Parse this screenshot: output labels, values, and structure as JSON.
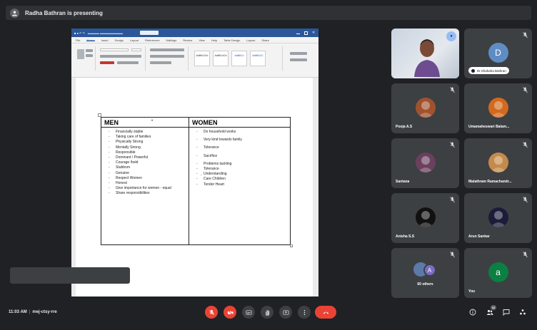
{
  "presenter_banner": {
    "text": "Radha Bathran is presenting"
  },
  "word": {
    "menu_tabs": [
      "File",
      "Home",
      "Insert",
      "Design",
      "Layout",
      "References",
      "Mailings",
      "Review",
      "View",
      "Help",
      "Table Design",
      "Layout",
      "Share"
    ],
    "active_tab": "Home"
  },
  "document": {
    "table": {
      "headers": [
        "MEN",
        "WOMEN"
      ],
      "men_items": [
        "Financially stable",
        "Taking care of families",
        "Physically Strong",
        "Mentally Strong",
        "Responsible",
        "Dominant / Powerful",
        "Courage /bold",
        "Stubborn",
        "Genuine",
        "Respect Women",
        "Honest",
        "Give importance for women - equal",
        "Share responsibilities"
      ],
      "women_items_spaced": [
        "Do household works",
        "Very kind towards family",
        "Tolerance",
        "Sacrifice"
      ],
      "women_items_tight": [
        "Problems tackling",
        "Tolerance",
        "Understanding",
        "Care Children",
        "Tender Heart"
      ]
    }
  },
  "participants": [
    {
      "name": "",
      "type": "video",
      "chip": ""
    },
    {
      "name": "Dr.Shahaha Bathran",
      "type": "letter",
      "letter": "D",
      "color": "#5f8dc3"
    },
    {
      "name": "Pooja A.S",
      "type": "photo",
      "color": "#a0522d"
    },
    {
      "name": "Umamaheswari Balam...",
      "type": "photo",
      "color": "#d2691e"
    },
    {
      "name": "Santana",
      "type": "photo",
      "color": "#6b3f5e"
    },
    {
      "name": "Malathram Ramachandr...",
      "type": "photo",
      "color": "#c58a4a"
    },
    {
      "name": "Anisha S.S",
      "type": "photo",
      "color": "#111111"
    },
    {
      "name": "Arun Sankar",
      "type": "photo",
      "color": "#1c1c3a"
    },
    {
      "name": "60 others",
      "type": "group"
    },
    {
      "name": "You",
      "type": "letter",
      "letter": "a",
      "color": "#0b8043"
    }
  ],
  "bottom_bar": {
    "time": "11:03 AM",
    "meeting_code": "mej-ctsy-rre",
    "people_count": "68"
  },
  "colors": {
    "background": "#202124",
    "tile": "#3c4043",
    "danger": "#ea4335",
    "word_blue": "#2b579a"
  },
  "icons": [
    "mic-off-icon",
    "camera-off-icon",
    "captions-icon",
    "raise-hand-icon",
    "present-icon",
    "more-options-icon",
    "leave-call-icon",
    "info-icon",
    "people-icon",
    "chat-icon",
    "activities-icon"
  ]
}
